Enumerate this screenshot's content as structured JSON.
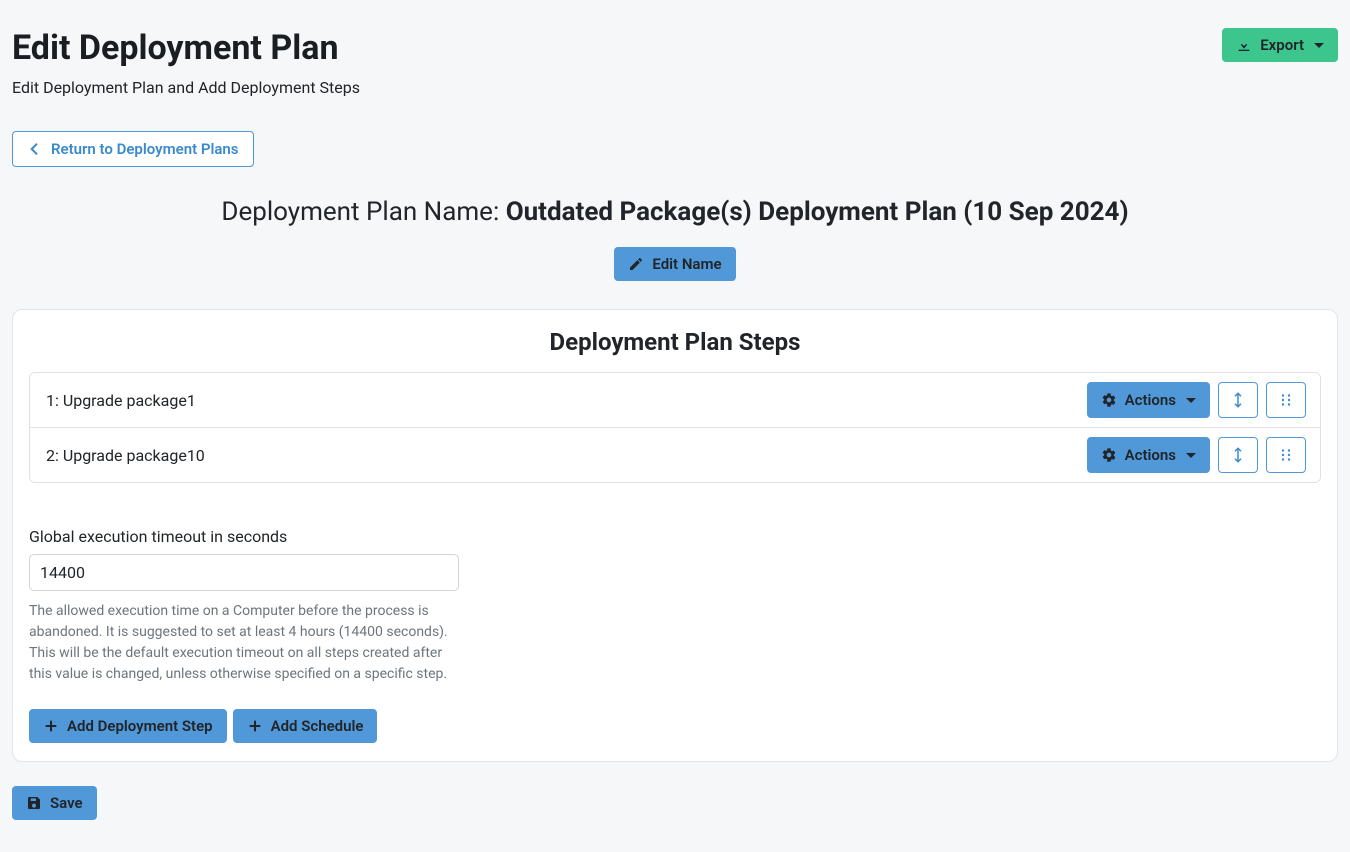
{
  "header": {
    "title": "Edit Deployment Plan",
    "subtitle": "Edit Deployment Plan and Add Deployment Steps",
    "export_label": "Export",
    "return_label": "Return to Deployment Plans"
  },
  "plan": {
    "name_prefix": "Deployment Plan Name: ",
    "name_value": "Outdated Package(s) Deployment Plan (10 Sep 2024)",
    "edit_name_label": "Edit Name"
  },
  "steps_section": {
    "heading": "Deployment Plan Steps",
    "actions_label": "Actions",
    "steps": [
      {
        "label": "1: Upgrade package1"
      },
      {
        "label": "2: Upgrade package10"
      }
    ]
  },
  "timeout": {
    "label": "Global execution timeout in seconds",
    "value": "14400",
    "help": "The allowed execution time on a Computer before the process is abandoned. It is suggested to set at least 4 hours (14400 seconds). This will be the default execution timeout on all steps created after this value is changed, unless otherwise specified on a specific step."
  },
  "buttons": {
    "add_step": "Add Deployment Step",
    "add_schedule": "Add Schedule",
    "save": "Save"
  }
}
